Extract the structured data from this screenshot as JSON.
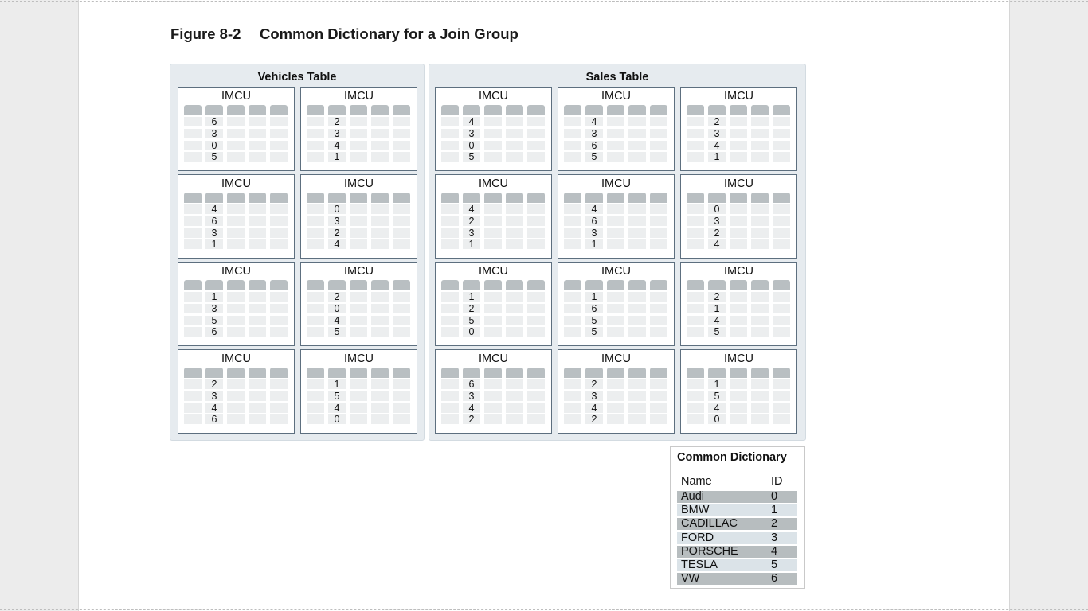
{
  "figure": {
    "number": "Figure 8-2",
    "title": "Common Dictionary for a Join Group"
  },
  "vehicles": {
    "title": "Vehicles Table",
    "imcu_label": "IMCU",
    "imcus": [
      [
        6,
        3,
        0,
        5
      ],
      [
        2,
        3,
        4,
        1
      ],
      [
        4,
        6,
        3,
        1
      ],
      [
        0,
        3,
        2,
        4
      ],
      [
        1,
        3,
        5,
        6
      ],
      [
        2,
        0,
        4,
        5
      ],
      [
        2,
        3,
        4,
        6
      ],
      [
        1,
        5,
        4,
        0
      ]
    ]
  },
  "sales": {
    "title": "Sales Table",
    "imcu_label": "IMCU",
    "imcus": [
      [
        4,
        3,
        0,
        5
      ],
      [
        4,
        3,
        6,
        5
      ],
      [
        2,
        3,
        4,
        1
      ],
      [
        4,
        2,
        3,
        1
      ],
      [
        4,
        6,
        3,
        1
      ],
      [
        0,
        3,
        2,
        4
      ],
      [
        1,
        2,
        5,
        0
      ],
      [
        1,
        6,
        5,
        5
      ],
      [
        2,
        1,
        4,
        5
      ],
      [
        6,
        3,
        4,
        2
      ],
      [
        2,
        3,
        4,
        2
      ],
      [
        1,
        5,
        4,
        0
      ]
    ]
  },
  "dictionary": {
    "title": "Common Dictionary",
    "col_name": "Name",
    "col_id": "ID",
    "rows": [
      {
        "name": "Audi",
        "id": "0"
      },
      {
        "name": "BMW",
        "id": "1"
      },
      {
        "name": "CADILLAC",
        "id": "2"
      },
      {
        "name": "FORD",
        "id": "3"
      },
      {
        "name": "PORSCHE",
        "id": "4"
      },
      {
        "name": "TESLA",
        "id": "5"
      },
      {
        "name": "VW",
        "id": "6"
      }
    ]
  }
}
